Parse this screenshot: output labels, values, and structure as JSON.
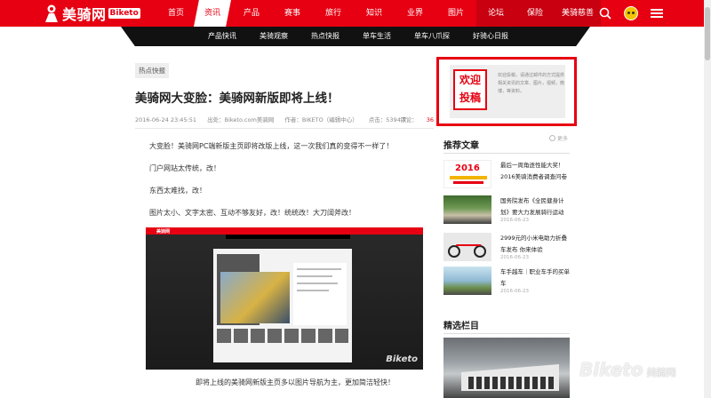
{
  "brand": {
    "name": "美骑网",
    "badge": "Biketo",
    "accent": "#e60012"
  },
  "nav": {
    "items": [
      {
        "label": "首页",
        "width": 40,
        "state": "normal"
      },
      {
        "label": "资讯",
        "width": 42,
        "state": "active"
      },
      {
        "label": "产品",
        "width": 46,
        "state": "normal"
      },
      {
        "label": "赛事",
        "width": 46,
        "state": "normal"
      },
      {
        "label": "旅行",
        "width": 46,
        "state": "normal"
      },
      {
        "label": "知识",
        "width": 46,
        "state": "normal"
      },
      {
        "label": "业界",
        "width": 46,
        "state": "normal"
      },
      {
        "label": "图片",
        "width": 46,
        "state": "normal"
      },
      {
        "label": "论坛",
        "width": 44,
        "state": "dark"
      },
      {
        "label": "保险",
        "width": 44,
        "state": "dark"
      },
      {
        "label": "美骑慈善",
        "width": 52,
        "state": "dark"
      }
    ]
  },
  "subnav": {
    "items": [
      "产品快讯",
      "美骑观察",
      "热点快报",
      "单车生活",
      "单车八爪探",
      "好骑心日报"
    ]
  },
  "article": {
    "tag": "热点快报",
    "title": "美骑网大变脸：美骑网新版即将上线！",
    "date": "2016-06-24 23:45:51",
    "source": "出处：Biketo.com美骑网",
    "author": "作者：BIKETO（编辑中心）",
    "views": "点击：5394次",
    "comments_label": "评论：",
    "comments_count": "36",
    "paragraphs": [
      "大变脸！美骑网PC端新版主页即将改版上线，这一次我们真的变得不一样了！",
      "门户网站太传统，改！",
      "东西太难找，改！",
      "图片太小、文字太密、互动不够友好，改！统统改！大刀阔斧改！"
    ],
    "screenshot_logo": "美骑网",
    "screenshot_watermark": "Biketo",
    "caption": "即将上线的美骑网新版主页多以图片导航为主，更加简洁轻快！"
  },
  "sidebar": {
    "contribute": {
      "stamp_line1": "欢迎",
      "stamp_line2": "投稿",
      "text": "欢迎投稿，请通过邮件的方式提供相关资讯的文章、图片，视频，微博，等资料。"
    },
    "recommended_title": "推荐文章",
    "more_label": "更多",
    "recommended": [
      {
        "title": "最后一周角逐性能大奖！2016美骑消费者调查问卷",
        "date": "",
        "thumb": "th1",
        "thumb_text": "2016"
      },
      {
        "title": "国务院发布《全民健身计划》要大力发展骑行运动",
        "date": "2016-06-23",
        "thumb": "th2",
        "thumb_text": ""
      },
      {
        "title": "2999元的小米电助力折叠车发布 你来体验",
        "date": "2016-06-23",
        "thumb": "th3",
        "thumb_text": ""
      },
      {
        "title": "车手越车｜职业车手的买单车",
        "date": "2016-06-23",
        "thumb": "th4",
        "thumb_text": ""
      }
    ],
    "featured_title": "精选栏目"
  },
  "watermark": {
    "text": "Biketo",
    "cn": "美骑网"
  }
}
